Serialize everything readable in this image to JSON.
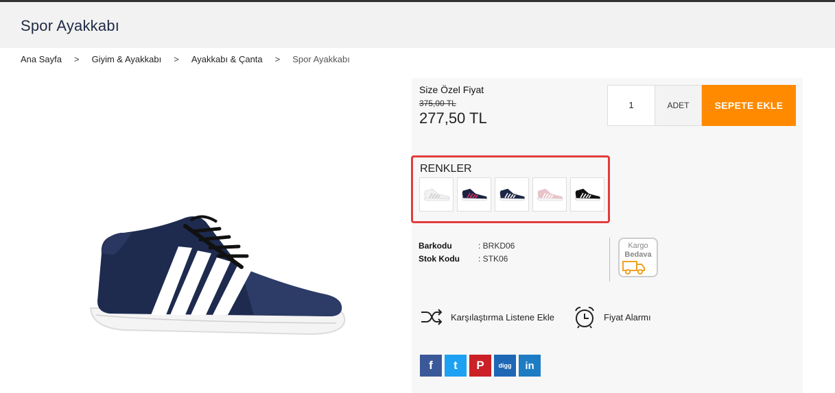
{
  "page": {
    "title": "Spor Ayakkabı"
  },
  "breadcrumb": {
    "items": [
      "Ana Sayfa",
      "Giyim & Ayakkabı",
      "Ayakkabı & Çanta"
    ],
    "current": "Spor Ayakkabı",
    "separator": ">"
  },
  "price": {
    "label": "Size Özel Fiyat",
    "old": "375,00 TL",
    "new": "277,50 TL"
  },
  "cart": {
    "quantity": "1",
    "unit": "ADET",
    "button": "SEPETE EKLE",
    "button_color": "#ff8a00"
  },
  "colors": {
    "title": "RENKLER",
    "highlight_color": "#e23b3b",
    "swatches": [
      {
        "name": "white-shoe",
        "body": "#f2f2f2",
        "stripe": "#cccccc"
      },
      {
        "name": "navy-pink-shoe",
        "body": "#1c2340",
        "stripe": "#e8336b"
      },
      {
        "name": "navy-white-shoe",
        "body": "#1c2845",
        "stripe": "#ffffff"
      },
      {
        "name": "pink-shoe",
        "body": "#e8c3c8",
        "stripe": "#ffffff"
      },
      {
        "name": "black-shoe",
        "body": "#111111",
        "stripe": "#ffffff"
      }
    ]
  },
  "meta": {
    "barcode_label": "Barkodu",
    "barcode_value": ": BRKD06",
    "stock_label": "Stok Kodu",
    "stock_value": ": STK06"
  },
  "cargo": {
    "line1": "Kargo",
    "line2": "Bedava",
    "icon": "truck-icon"
  },
  "actions": {
    "compare": "Karşılaştırma Listene Ekle",
    "alarm": "Fiyat Alarmı"
  },
  "social": [
    {
      "name": "facebook",
      "glyph": "f",
      "color": "#3b5998"
    },
    {
      "name": "twitter",
      "glyph": "t",
      "color": "#1da1f2"
    },
    {
      "name": "pinterest",
      "glyph": "P",
      "color": "#cb2027"
    },
    {
      "name": "digg",
      "glyph": "digg",
      "color": "#1d67b5"
    },
    {
      "name": "linkedin",
      "glyph": "in",
      "color": "#1d7cc2"
    }
  ]
}
